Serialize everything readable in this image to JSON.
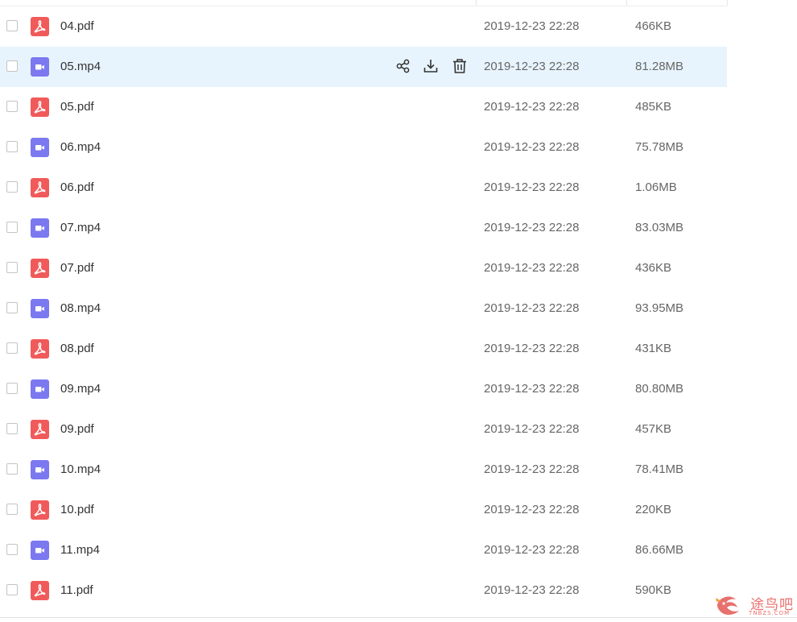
{
  "file_list": {
    "hover_index": 1,
    "items": [
      {
        "name": "04.pdf",
        "type": "pdf",
        "date": "2019-12-23 22:28",
        "size": "466KB"
      },
      {
        "name": "05.mp4",
        "type": "video",
        "date": "2019-12-23 22:28",
        "size": "81.28MB"
      },
      {
        "name": "05.pdf",
        "type": "pdf",
        "date": "2019-12-23 22:28",
        "size": "485KB"
      },
      {
        "name": "06.mp4",
        "type": "video",
        "date": "2019-12-23 22:28",
        "size": "75.78MB"
      },
      {
        "name": "06.pdf",
        "type": "pdf",
        "date": "2019-12-23 22:28",
        "size": "1.06MB"
      },
      {
        "name": "07.mp4",
        "type": "video",
        "date": "2019-12-23 22:28",
        "size": "83.03MB"
      },
      {
        "name": "07.pdf",
        "type": "pdf",
        "date": "2019-12-23 22:28",
        "size": "436KB"
      },
      {
        "name": "08.mp4",
        "type": "video",
        "date": "2019-12-23 22:28",
        "size": "93.95MB"
      },
      {
        "name": "08.pdf",
        "type": "pdf",
        "date": "2019-12-23 22:28",
        "size": "431KB"
      },
      {
        "name": "09.mp4",
        "type": "video",
        "date": "2019-12-23 22:28",
        "size": "80.80MB"
      },
      {
        "name": "09.pdf",
        "type": "pdf",
        "date": "2019-12-23 22:28",
        "size": "457KB"
      },
      {
        "name": "10.mp4",
        "type": "video",
        "date": "2019-12-23 22:28",
        "size": "78.41MB"
      },
      {
        "name": "10.pdf",
        "type": "pdf",
        "date": "2019-12-23 22:28",
        "size": "220KB"
      },
      {
        "name": "11.mp4",
        "type": "video",
        "date": "2019-12-23 22:28",
        "size": "86.66MB"
      },
      {
        "name": "11.pdf",
        "type": "pdf",
        "date": "2019-12-23 22:28",
        "size": "590KB"
      }
    ],
    "hover_actions": [
      {
        "name": "share-icon"
      },
      {
        "name": "download-icon"
      },
      {
        "name": "delete-icon"
      }
    ]
  },
  "watermark": {
    "text": "途鸟吧",
    "subtext": "TNBZS.COM",
    "logo": "bird-logo-icon"
  },
  "colors": {
    "pdf_icon": "#f15a5a",
    "video_icon": "#7b78f0",
    "hover_row": "#e8f4fd",
    "watermark": "#e8706d"
  }
}
